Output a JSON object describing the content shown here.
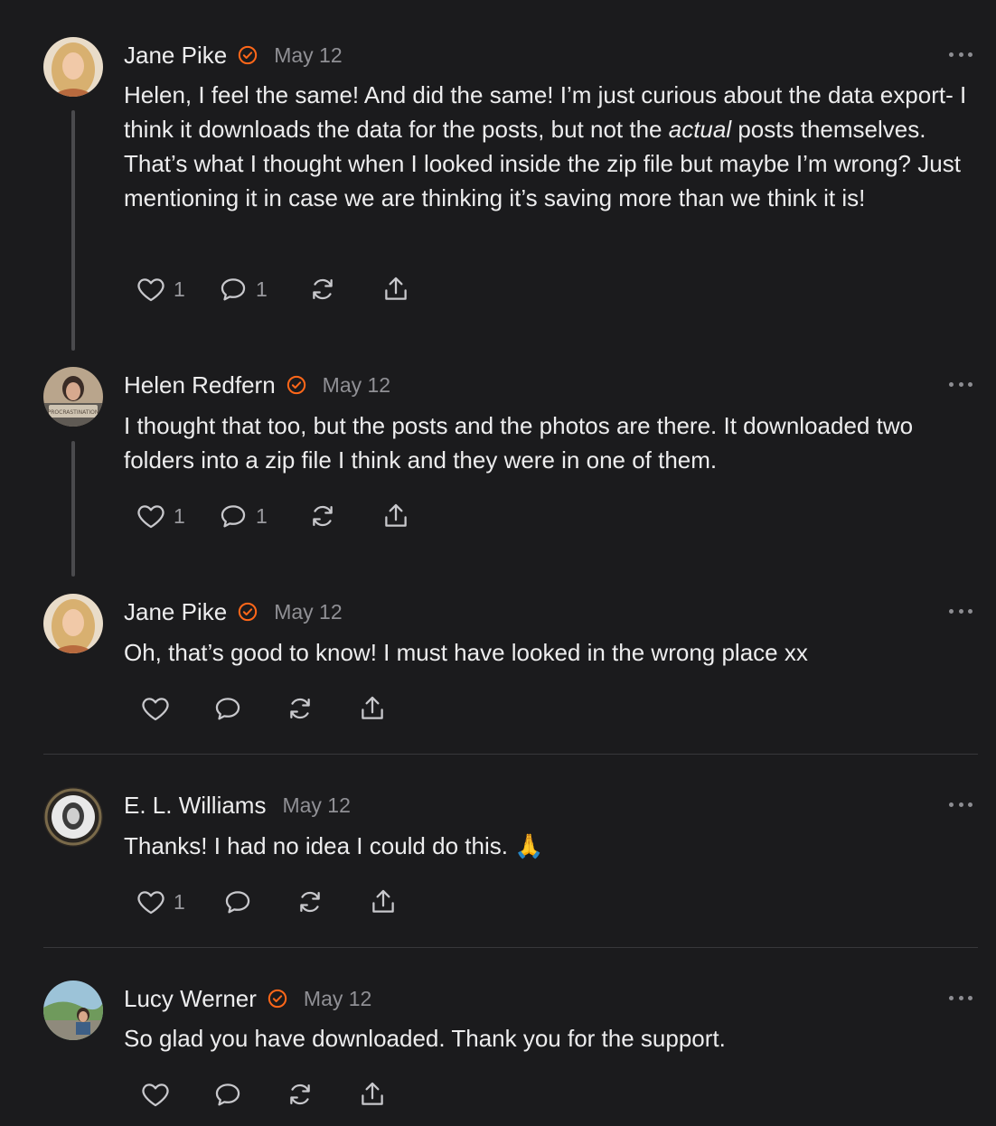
{
  "comments": [
    {
      "author": "Jane Pike",
      "verified": true,
      "date": "May 12",
      "text_before": "Helen, I feel the same! And did the same! I’m just curious about the data export- I think it downloads the data for the posts, but not the ",
      "text_em": "actual",
      "text_after": " posts themselves. That’s what I thought when I looked inside the zip file but maybe I’m wrong? Just mentioning it in case we are thinking it’s saving more than we think it is!",
      "like_count": "1",
      "reply_count": "1"
    },
    {
      "author": "Helen Redfern",
      "verified": true,
      "date": "May 12",
      "text": "I thought that too, but the posts and the photos are there. It downloaded two folders into a zip file I think and they were in one of them.",
      "like_count": "1",
      "reply_count": "1",
      "avatar_text": "PROCRASTINATION"
    },
    {
      "author": "Jane Pike",
      "verified": true,
      "date": "May 12",
      "text": "Oh, that’s good to know! I must have looked in the wrong place xx"
    },
    {
      "author": "E. L. Williams",
      "verified": false,
      "date": "May 12",
      "text": "Thanks! I had no idea I could do this.",
      "emoji": "🙏",
      "like_count": "1"
    },
    {
      "author": "Lucy Werner",
      "verified": true,
      "date": "May 12",
      "text": "So glad you have downloaded. Thank you for the support."
    }
  ],
  "icons": {
    "like": "heart-icon",
    "reply": "speech-bubble-icon",
    "restack": "restack-icon",
    "share": "share-icon",
    "more": "more-horizontal-icon",
    "verified": "verified-badge-icon"
  },
  "colors": {
    "background": "#1b1b1d",
    "text": "#ededee",
    "muted": "#909095",
    "accent": "#ff6719"
  }
}
